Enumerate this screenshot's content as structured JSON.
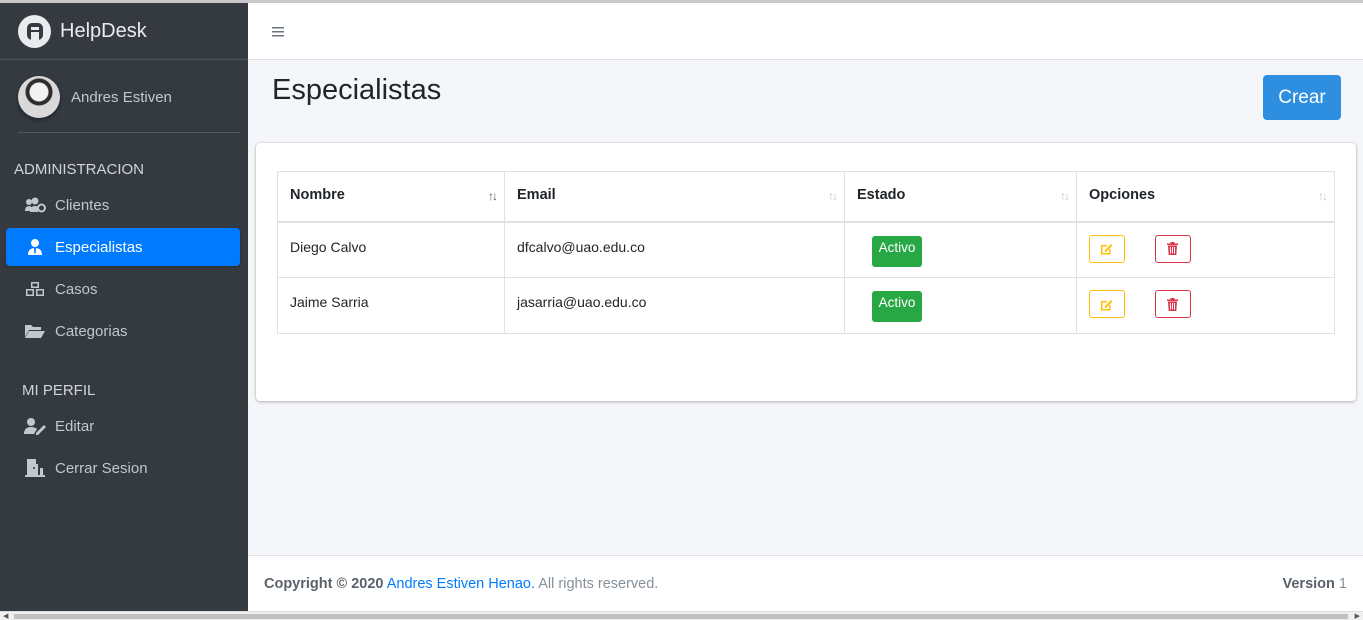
{
  "brand": {
    "name": "HelpDesk",
    "logo_icon": "helpdesk-logo-icon"
  },
  "user": {
    "name": "Andres Estiven"
  },
  "sidebar": {
    "sections": [
      {
        "header": "ADMINISTRACION",
        "items": [
          {
            "label": "Clientes",
            "icon": "users-cog-icon"
          },
          {
            "label": "Especialistas",
            "icon": "user-tie-icon",
            "active": true
          },
          {
            "label": "Casos",
            "icon": "cubes-icon"
          },
          {
            "label": "Categorias",
            "icon": "folder-open-icon"
          }
        ]
      },
      {
        "header": "MI PERFIL",
        "items": [
          {
            "label": "Editar",
            "icon": "user-edit-icon"
          },
          {
            "label": "Cerrar Sesion",
            "icon": "door-exit-icon"
          }
        ]
      }
    ]
  },
  "header": {
    "menu_icon": "hamburger-icon"
  },
  "page": {
    "title": "Especialistas",
    "create_label": "Crear"
  },
  "table": {
    "columns": [
      "Nombre",
      "Email",
      "Estado",
      "Opciones"
    ],
    "rows": [
      {
        "nombre": "Diego Calvo",
        "email": "dfcalvo@uao.edu.co",
        "estado": "Activo"
      },
      {
        "nombre": "Jaime Sarria",
        "email": "jasarria@uao.edu.co",
        "estado": "Activo"
      }
    ]
  },
  "footer": {
    "copyright": "Copyright © 2020",
    "author": "Andres Estiven Henao.",
    "rights": "All rights reserved.",
    "version_label": "Version",
    "version": "1"
  },
  "colors": {
    "primary": "#007bff",
    "sidebar": "#343a40",
    "success": "#28a745",
    "warning": "#ffc107",
    "danger": "#dc3545"
  }
}
